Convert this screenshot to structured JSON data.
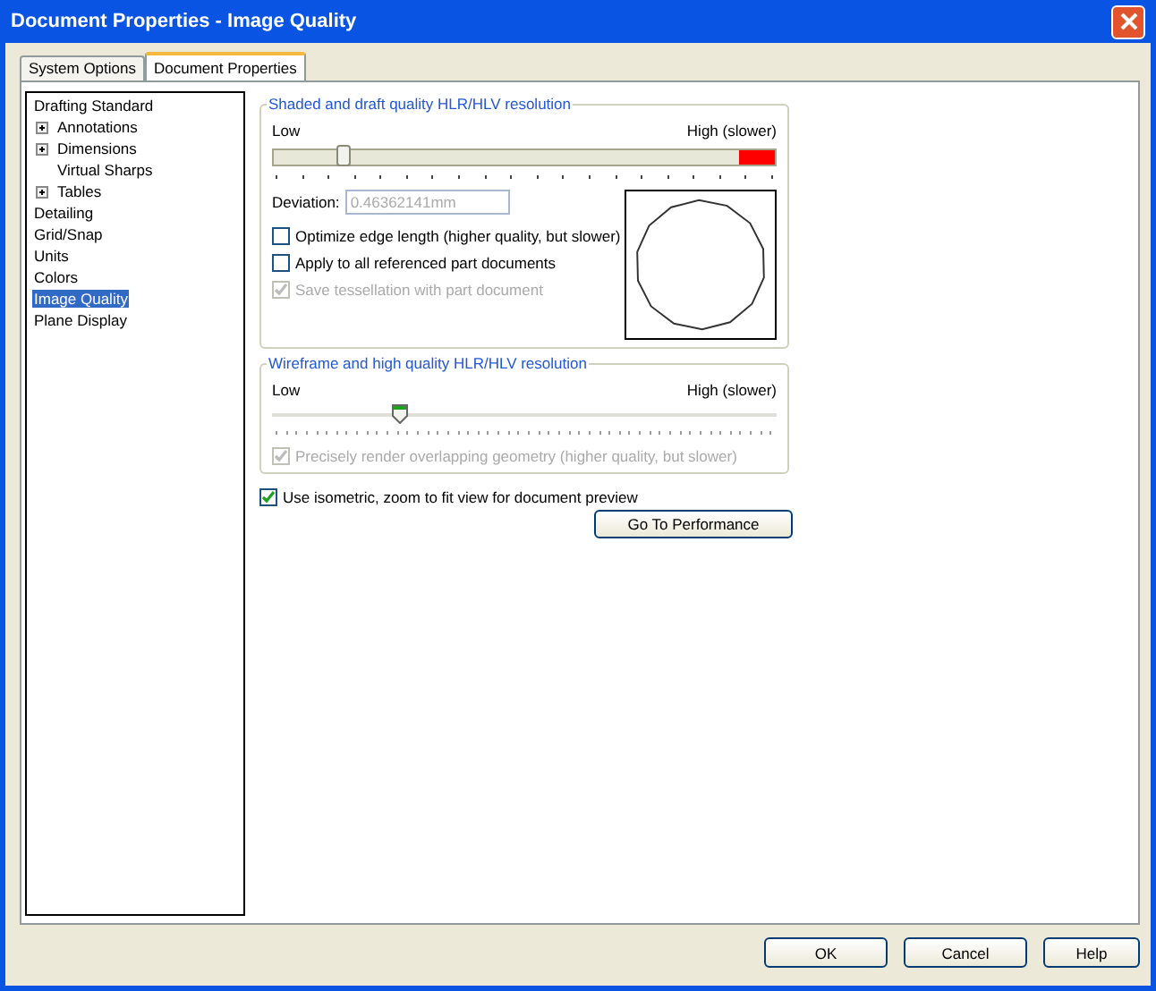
{
  "window": {
    "title": "Document Properties - Image Quality"
  },
  "tabs": [
    {
      "label": "System Options",
      "selected": false
    },
    {
      "label": "Document Properties",
      "selected": true
    }
  ],
  "tree": [
    {
      "label": "Drafting Standard",
      "selected": false,
      "children": [
        {
          "label": "Annotations",
          "selected": false,
          "expanded": false
        },
        {
          "label": "Dimensions",
          "selected": false,
          "expanded": false
        },
        {
          "label": "Virtual Sharps",
          "selected": false
        },
        {
          "label": "Tables",
          "selected": false,
          "expanded": false
        }
      ]
    },
    {
      "label": "Detailing",
      "selected": false
    },
    {
      "label": "Grid/Snap",
      "selected": false
    },
    {
      "label": "Units",
      "selected": false
    },
    {
      "label": "Colors",
      "selected": false
    },
    {
      "label": "Image Quality",
      "selected": true
    },
    {
      "label": "Plane Display",
      "selected": false
    }
  ],
  "shaded": {
    "title": "Shaded and draft quality HLR/HLV resolution",
    "low": "Low",
    "high": "High (slower)",
    "level": 0.14,
    "deviation_label": "Deviation:",
    "deviation": "0.46362141mm",
    "options": [
      {
        "label": "Optimize edge length (higher quality, but slower)",
        "checked": false,
        "disabled": false
      },
      {
        "label": "Apply to all referenced part documents",
        "checked": false,
        "disabled": false
      },
      {
        "label": "Save tessellation with part document",
        "checked": true,
        "disabled": true
      }
    ]
  },
  "wireframe": {
    "title": "Wireframe and high quality HLR/HLV resolution",
    "low": "Low",
    "high": "High (slower)",
    "level": 0.25,
    "options": [
      {
        "label": "Precisely render overlapping geometry (higher quality, but slower)",
        "checked": true,
        "disabled": true
      }
    ]
  },
  "isometric": {
    "label": "Use isometric, zoom to fit view for document preview",
    "checked": true,
    "disabled": false
  },
  "performance_button": "Go To Performance",
  "buttons": [
    "OK",
    "Cancel",
    "Help"
  ]
}
